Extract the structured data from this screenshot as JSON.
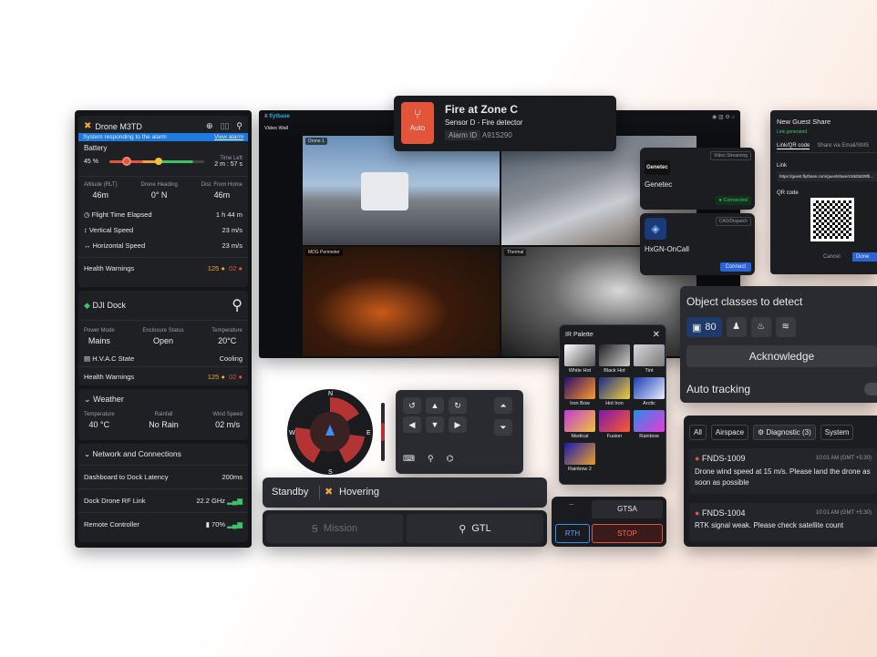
{
  "drone": {
    "title": "Drone M3TD",
    "banner": "System responding to the alarm",
    "banner_link": "View alarm",
    "battery_label": "Battery",
    "battery_pct": "45 %",
    "battery_level": 0.45,
    "time_left_label": "Time Left",
    "time_left": "2 m : 57 s",
    "stats": [
      {
        "label": "Altitude (RLT)",
        "value": "46m"
      },
      {
        "label": "Drone Heading",
        "value": "0° N"
      },
      {
        "label": "Dist. From Home",
        "value": "46m"
      }
    ],
    "metrics": [
      {
        "icon": "clock-icon",
        "label": "Flight Time Elapsed",
        "value": "1 h 44 m"
      },
      {
        "icon": "vertical-speed-icon",
        "label": "Vertical Speed",
        "value": "23 m/s"
      },
      {
        "icon": "horizontal-speed-icon",
        "label": "Horizontal Speed",
        "value": "23 m/s"
      }
    ],
    "health_label": "Health Warnings",
    "health_warn": "125",
    "health_err": "02"
  },
  "dock": {
    "title": "DJI Dock",
    "stats": [
      {
        "label": "Power Mode",
        "value": "Mains"
      },
      {
        "label": "Enclosure Status",
        "value": "Open"
      },
      {
        "label": "Temperature",
        "value": "20°C"
      }
    ],
    "hvac_label": "H.V.A.C State",
    "hvac_value": "Cooling",
    "health_label": "Health Warnings",
    "health_warn": "125",
    "health_err": "02"
  },
  "weather": {
    "title": "Weather",
    "stats": [
      {
        "label": "Temperature",
        "value": "40 °C"
      },
      {
        "label": "Rainfall",
        "value": "No Rain"
      },
      {
        "label": "Wind Speed",
        "value": "02 m/s"
      }
    ]
  },
  "network": {
    "title": "Network and Connections",
    "items": [
      {
        "label": "Dashboard to Dock Latency",
        "value": "200ms"
      },
      {
        "label": "Dock Drone RF Link",
        "value": "22.2 GHz"
      },
      {
        "label": "Remote Controller",
        "value": "70%"
      }
    ]
  },
  "video": {
    "brand": "flytbase",
    "menu1": "Video Wall",
    "tiles": [
      "Drone 1",
      "MDG Perimeter",
      "Thermal"
    ]
  },
  "alarm": {
    "title": "Fire at Zone C",
    "subtitle": "Sensor D - Fire detector",
    "badge": "Auto",
    "alarm_id_label": "Alarm ID",
    "alarm_id": "A91S290"
  },
  "genetec": {
    "logo": "Genetec",
    "tag": "Video Streaming",
    "name": "Genetec",
    "status": "Connected"
  },
  "hxgn": {
    "tag": "CAD/Dispatch",
    "name": "HxGN-OnCall",
    "button": "Connect"
  },
  "guest": {
    "title": "New Guest Share",
    "link_status": "Link generated",
    "tab1": "Link/QR code",
    "tab2": "Share via Email/SMS",
    "link_label": "Link",
    "link": "https://guest.flytbase.com/guestshare/c3dd3d29fb...",
    "qr_label": "QR code",
    "cancel": "Cancel",
    "done": "Done"
  },
  "objects": {
    "title": "Object classes to detect",
    "count": "80",
    "acknowledge": "Acknowledge",
    "tracking": "Auto tracking"
  },
  "palette": {
    "title": "IR Palette",
    "items": [
      "White Hot",
      "Black Hot",
      "Tint",
      "Iron Bow",
      "Hot Iron",
      "Arctic",
      "Medical",
      "Fusion",
      "Rainbow",
      "Rainbow 2"
    ],
    "colors": [
      [
        "#ffffff",
        "#555555"
      ],
      [
        "#222222",
        "#cccccc"
      ],
      [
        "#d8d8d8",
        "#7a7a7a"
      ],
      [
        "#2a0d6a",
        "#ff9a2a"
      ],
      [
        "#1e2a8a",
        "#f0d23a"
      ],
      [
        "#1a3ab0",
        "#e8f0ff"
      ],
      [
        "#c23ad8",
        "#f2c23a"
      ],
      [
        "#7a1ab0",
        "#ff5a2a"
      ],
      [
        "#2a8ae8",
        "#e83ad8"
      ],
      [
        "#1a1ab0",
        "#e8a02a"
      ]
    ]
  },
  "compass": {
    "n": "N",
    "e": "E",
    "s": "S",
    "w": "W"
  },
  "status": {
    "standby": "Standby",
    "hovering": "Hovering"
  },
  "mission": {
    "mission": "Mission",
    "gtl": "GTL"
  },
  "rth": {
    "gtsa": "GTSA",
    "rth": "RTH",
    "stop": "STOP"
  },
  "alerts": {
    "filters": [
      "All",
      "Airspace",
      "Diagnostic (3)",
      "System"
    ],
    "items": [
      {
        "id": "FNDS-1009",
        "time": "10:01 AM (GMT +5:30)",
        "text": "Drone wind speed at 15 m/s. Please land the drone as soon as possible"
      },
      {
        "id": "FNDS-1004",
        "time": "10:01 AM (GMT +5:30)",
        "text": "RTK signal weak. Please check satellite count"
      }
    ]
  }
}
